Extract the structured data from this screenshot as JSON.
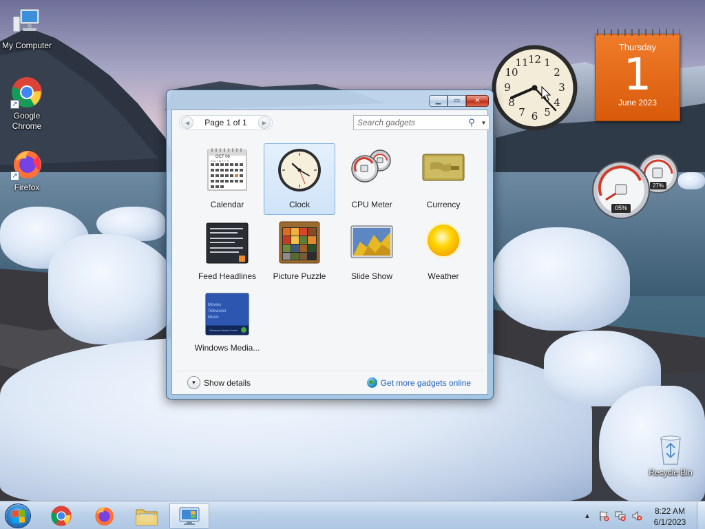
{
  "desktop": {
    "icons": [
      {
        "label": "My Computer",
        "icon": "computer-icon"
      },
      {
        "label": "Google Chrome",
        "icon": "chrome-icon"
      },
      {
        "label": "Firefox",
        "icon": "firefox-icon"
      },
      {
        "label": "Recycle Bin",
        "icon": "recycle-bin-icon"
      }
    ],
    "calendar_gadget": {
      "weekday": "Thursday",
      "day": "1",
      "month_year": "June 2023"
    },
    "cpu_gadget": {
      "cpu": "05%",
      "memory": "27%"
    }
  },
  "gadget_window": {
    "pager_label": "Page 1 of 1",
    "search_placeholder": "Search gadgets",
    "gadgets": [
      {
        "label": "Calendar"
      },
      {
        "label": "Clock"
      },
      {
        "label": "CPU Meter"
      },
      {
        "label": "Currency"
      },
      {
        "label": "Feed Headlines"
      },
      {
        "label": "Picture Puzzle"
      },
      {
        "label": "Slide Show"
      },
      {
        "label": "Weather"
      },
      {
        "label": "Windows Media..."
      }
    ],
    "selected": "Clock",
    "calendar_thumb": {
      "month": "OCT 06",
      "days": "S M T W T F S"
    },
    "media_thumb": [
      "Movies",
      "Television",
      "Music"
    ],
    "media_thumb_footer": "Windows Media Center",
    "show_details": "Show details",
    "get_more": "Get more gadgets online"
  },
  "taskbar": {
    "pinned": [
      "chrome-icon",
      "firefox-icon",
      "explorer-folder-icon",
      "gadgets-icon"
    ],
    "time": "8:22 AM",
    "date": "6/1/2023"
  },
  "colors": {
    "accent": "#1a5fb4",
    "calendar_orange": "#e0620f",
    "selection": "#cfe3f8"
  }
}
